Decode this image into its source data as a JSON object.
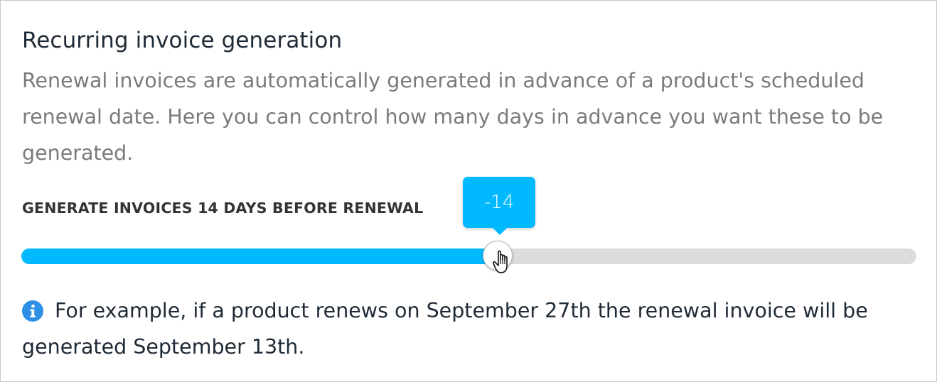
{
  "section": {
    "title": "Recurring invoice generation",
    "description": "Renewal invoices are automatically generated in advance of a product's scheduled renewal date. Here you can control how many days in advance you want these to be generated."
  },
  "slider": {
    "label": "GENERATE INVOICES 14 DAYS BEFORE RENEWAL",
    "tooltip_value": "-14",
    "fill_fraction": 0.53,
    "accent_color": "#00b9ff",
    "track_color": "#dcdcdc"
  },
  "info": {
    "icon": "info-circle-icon",
    "icon_color": "#2d8fe6",
    "text": "For example, if a product renews on September 27th the renewal invoice will be generated September 13th."
  },
  "cursor": {
    "icon": "hand-pointer-icon"
  }
}
